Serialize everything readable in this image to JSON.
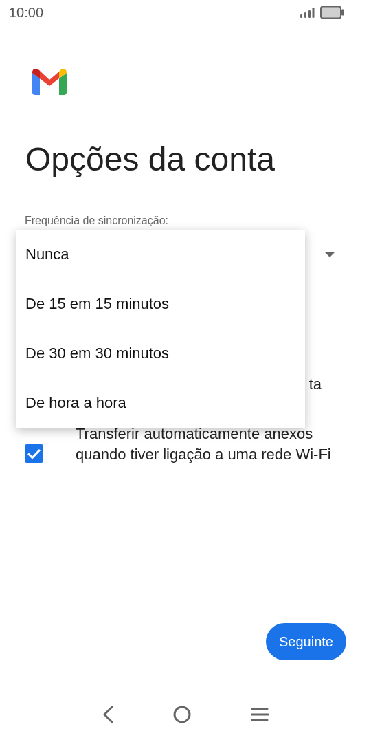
{
  "status_bar": {
    "time": "10:00"
  },
  "title": "Opções da conta",
  "sync": {
    "label": "Frequência de sincronização:",
    "options": [
      "Nunca",
      "De 15 em 15 minutos",
      "De 30 em 30 minutos",
      "De hora a hora"
    ]
  },
  "partial_text": "ta",
  "attachments_option": {
    "label": "Transferir automaticamente anexos quando tiver ligação a uma rede Wi-Fi",
    "checked": true
  },
  "next_button": "Seguinte"
}
